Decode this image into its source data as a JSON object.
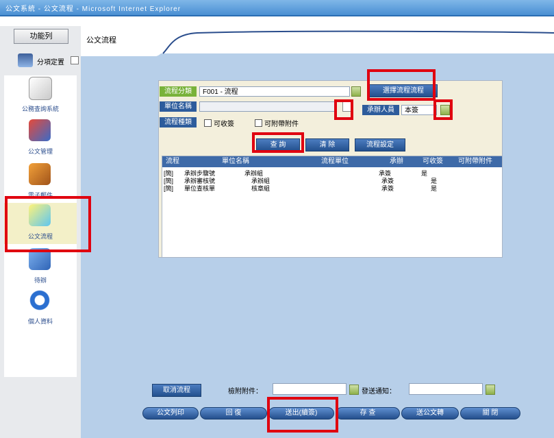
{
  "window": {
    "title": "公文系統 - 公文流程 - Microsoft Internet Explorer"
  },
  "sidebar": {
    "header": "功能列",
    "tools_label": "分項定置",
    "items": [
      {
        "label": "公務查詢系統"
      },
      {
        "label": "公文管理"
      },
      {
        "label": "電子郵件"
      },
      {
        "label": "公文流程"
      },
      {
        "label": "待辦"
      },
      {
        "label": "個人資料"
      }
    ]
  },
  "main": {
    "tab_title": "公文流程"
  },
  "form": {
    "flow_label": "流程分類",
    "flow_value": "F001 - 流程",
    "dept_label": "單位名稱",
    "dept_value": "",
    "type_label": "流程種類",
    "check1": "可收簽",
    "check2": "可附帶附件",
    "right_btn": "選擇流程流程",
    "person_label": "承辦人員",
    "person_value": "本簽",
    "btn_query": "查 詢",
    "btn_clear": "清 除",
    "btn_setting": "流程設定"
  },
  "table": {
    "headers": [
      "流程",
      "單位名稱",
      "流程單位",
      "承辦",
      "可收簽",
      "可附帶附件"
    ],
    "rows": [
      [
        "[簡]",
        "承辦步驟號",
        "承辦組",
        "承簽",
        "是"
      ],
      [
        "[簡]",
        "承辦審核號",
        "承辦組",
        "承簽",
        "是"
      ],
      [
        "[簡]",
        "單位查核單",
        "核章組",
        "承簽",
        "是"
      ]
    ]
  },
  "bottom": {
    "cancel_btn": "取消流程",
    "attach_label": "檢附附件：",
    "attach_value": "",
    "notify_label": "發送通知：",
    "notify_value": "",
    "btns": [
      "公文列印",
      "回 復",
      "送出(續簽)",
      "存 查",
      "送公文轉",
      "關 閉"
    ]
  },
  "colors": {
    "highlight": "#e0000f",
    "panel": "#f3efdc",
    "main_bg": "#b7cfe9"
  }
}
